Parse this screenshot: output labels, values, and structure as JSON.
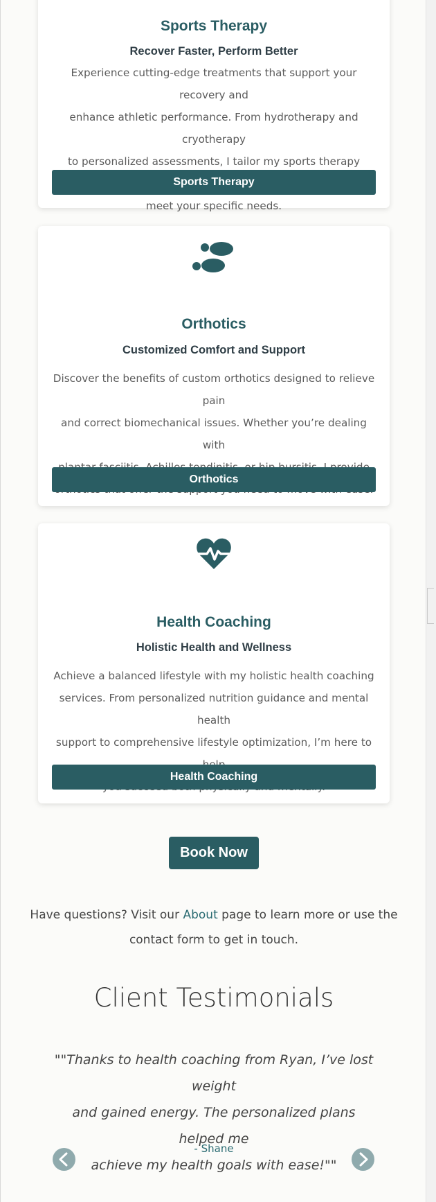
{
  "services": [
    {
      "icon": "sports-therapy-icon",
      "title": "Sports Therapy",
      "subtitle": "Recover Faster, Perform Better",
      "lines": [
        "Experience cutting-edge treatments that support your recovery and",
        "enhance athletic performance. From hydrotherapy and cryotherapy",
        "to personalized assessments, I tailor my sports therapy services to",
        "meet your specific needs."
      ],
      "button": "Sports Therapy"
    },
    {
      "icon": "footprints-icon",
      "title": "Orthotics",
      "subtitle": "Customized Comfort and Support",
      "lines": [
        "Discover the benefits of custom orthotics designed to relieve pain",
        "and correct biomechanical issues. Whether you’re dealing with",
        "plantar fasciitis, Achilles tendinitis, or hip bursitis, I provide",
        "orthotics that offer the support you need to move with ease."
      ],
      "button": "Orthotics"
    },
    {
      "icon": "heart-pulse-icon",
      "title": "Health Coaching",
      "subtitle": "Holistic Health and Wellness",
      "lines": [
        "Achieve a balanced lifestyle with my holistic health coaching",
        "services. From personalized nutrition guidance and mental health",
        "support to comprehensive lifestyle optimization, I’m here to help",
        "you succeed both physically and mentally."
      ],
      "button": "Health Coaching"
    }
  ],
  "book_button": "Book Now",
  "questions": {
    "before": "Have questions? Visit our ",
    "link": "About",
    "after": " page to learn more or use the contact form to get in touch."
  },
  "testimonials": {
    "heading": "Client Testimonials",
    "quote_lines": [
      "\"\"Thanks to health coaching from Ryan, I’ve lost weight",
      "and gained energy. The personalized plans helped me",
      "achieve my health goals with ease!\"\""
    ],
    "author": "- Shane"
  },
  "colors": {
    "accent": "#2a5d63",
    "link": "#2a6b72",
    "arrow": "#8faaad",
    "background": "#fbfbf9"
  }
}
